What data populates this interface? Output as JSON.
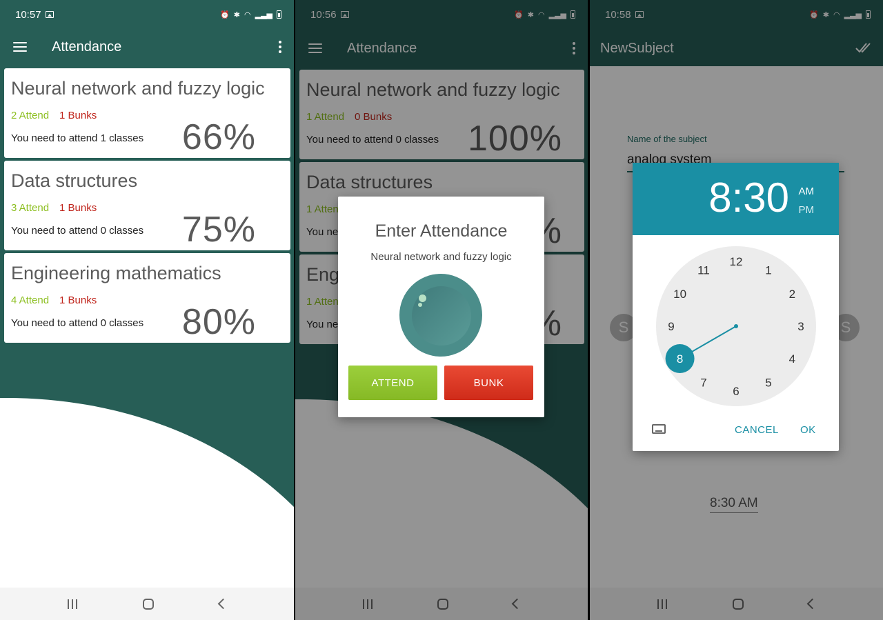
{
  "colors": {
    "primary": "#275e56",
    "primary_dark": "#1f3f3a",
    "accent_attend": "#8dbf21",
    "accent_bunk": "#c0261d",
    "picker_header": "#1a8fa4"
  },
  "screen1": {
    "status": {
      "time": "10:57"
    },
    "appbar": {
      "title": "Attendance"
    },
    "subjects": [
      {
        "name": "Neural network and fuzzy logic",
        "attend": "2 Attend",
        "bunks": "1 Bunks",
        "need": "You need to attend 1 classes",
        "percent": "66%"
      },
      {
        "name": "Data structures",
        "attend": "3 Attend",
        "bunks": "1 Bunks",
        "need": "You need to attend 0 classes",
        "percent": "75%"
      },
      {
        "name": "Engineering mathematics",
        "attend": "4 Attend",
        "bunks": "1 Bunks",
        "need": "You need to attend 0 classes",
        "percent": "80%"
      }
    ]
  },
  "screen2": {
    "status": {
      "time": "10:56"
    },
    "appbar": {
      "title": "Attendance"
    },
    "subjects": [
      {
        "name": "Neural network and fuzzy logic",
        "attend": "1 Attend",
        "bunks": "0 Bunks",
        "need": "You need to attend 0 classes",
        "percent": "100%"
      },
      {
        "name": "Data structures",
        "attend": "1 Atten",
        "need": "You ne",
        "percent": "%"
      },
      {
        "name": "Eng",
        "attend": "1 Atten",
        "need": "You ne",
        "percent": "%"
      }
    ],
    "dialog": {
      "title": "Enter Attendance",
      "subject": "Neural network and fuzzy logic",
      "attend_button": "ATTEND",
      "bunk_button": "BUNK"
    }
  },
  "screen3": {
    "status": {
      "time": "10:58"
    },
    "appbar": {
      "title": "NewSubject",
      "action_icon": "double-check-icon"
    },
    "form": {
      "name_label": "Name of the subject",
      "name_value": "analog system",
      "side_button_letter": "S",
      "time_value": "8:30 AM"
    },
    "time_picker": {
      "time": "8:30",
      "am": "AM",
      "pm": "PM",
      "selected_hour": 8,
      "selected_minute": 30,
      "hours": [
        "12",
        "1",
        "2",
        "3",
        "4",
        "5",
        "6",
        "7",
        "8",
        "9",
        "10",
        "11"
      ],
      "cancel": "CANCEL",
      "ok": "OK"
    }
  }
}
